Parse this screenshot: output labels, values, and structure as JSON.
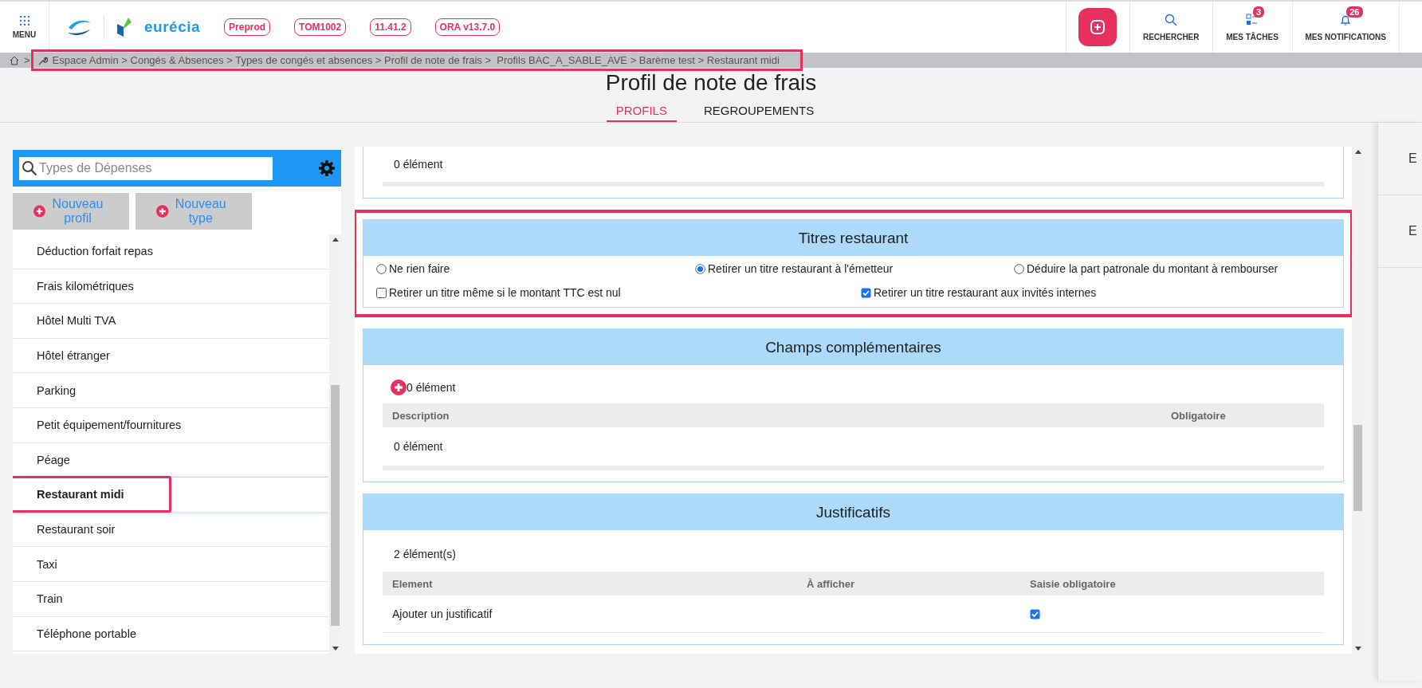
{
  "header": {
    "menu_label": "MENU",
    "brand": "eurécia",
    "env_badges": [
      "Preprod",
      "TOM1002",
      "11.41.2",
      "ORA v13.7.0"
    ],
    "actions": [
      {
        "kind": "search",
        "label": "RECHERCHER"
      },
      {
        "kind": "tasks",
        "label": "MES TÂCHES",
        "count": "3"
      },
      {
        "kind": "notifications",
        "label": "MES NOTIFICATIONS",
        "count": "26"
      }
    ]
  },
  "breadcrumb": {
    "separator": ">",
    "path": "Espace Admin > Congés & Absences > Types de congés et absences > Profil de note de frais >  Profils BAC_A_SABLE_AVE > Barème test > Restaurant midi",
    "highlighted": true
  },
  "page_title": "Profil de note de frais",
  "tabs": [
    {
      "label": "PROFILS",
      "selected": true
    },
    {
      "label": "REGROUPEMENTS",
      "selected": false
    }
  ],
  "sidebar": {
    "search": {
      "placeholder": "Types de Dépenses"
    },
    "buttons": [
      "Nouveau profil",
      "Nouveau type"
    ],
    "items": [
      {
        "label": "Déduction forfait repas",
        "selected": false,
        "highlighted": false
      },
      {
        "label": "Frais kilométriques",
        "selected": false,
        "highlighted": false
      },
      {
        "label": "Hôtel Multi TVA",
        "selected": false,
        "highlighted": false
      },
      {
        "label": "Hôtel étranger",
        "selected": false,
        "highlighted": false
      },
      {
        "label": "Parking",
        "selected": false,
        "highlighted": false
      },
      {
        "label": "Petit équipement/fournitures",
        "selected": false,
        "highlighted": false
      },
      {
        "label": "Péage",
        "selected": false,
        "highlighted": false
      },
      {
        "label": "Restaurant midi",
        "selected": true,
        "highlighted": true
      },
      {
        "label": "Restaurant soir",
        "selected": false,
        "highlighted": false
      },
      {
        "label": "Taxi",
        "selected": false,
        "highlighted": false
      },
      {
        "label": "Train",
        "selected": false,
        "highlighted": false
      },
      {
        "label": "Téléphone portable",
        "selected": false,
        "highlighted": false
      }
    ]
  },
  "sections": [
    {
      "kind": "summary",
      "count": "0 élément"
    },
    {
      "kind": "options",
      "title": "Titres restaurant",
      "highlighted": true,
      "radios": [
        {
          "label": "Ne rien faire",
          "selected": false
        },
        {
          "label": "Retirer un titre restaurant à l'émetteur",
          "selected": true
        },
        {
          "label": "Déduire la part patronale du montant à rembourser",
          "selected": false
        }
      ],
      "checkboxes": [
        {
          "label": "Retirer un titre même si le montant TTC est nul",
          "checked": false
        },
        {
          "label": "Retirer un titre restaurant aux invités internes",
          "checked": true
        }
      ]
    },
    {
      "kind": "table",
      "title": "Champs complémentaires",
      "add_count": "0 élément",
      "columns": [
        "Description",
        "Obligatoire"
      ],
      "empty": "0 élément"
    },
    {
      "kind": "table",
      "title": "Justificatifs",
      "count": "2 élément(s)",
      "columns": [
        "Element",
        "À afficher",
        "Saisie obligatoire"
      ],
      "rows": [
        {
          "label": "Ajouter un justificatif",
          "required": true
        }
      ]
    }
  ],
  "right_panel": {
    "items": [
      "E",
      "E"
    ]
  }
}
